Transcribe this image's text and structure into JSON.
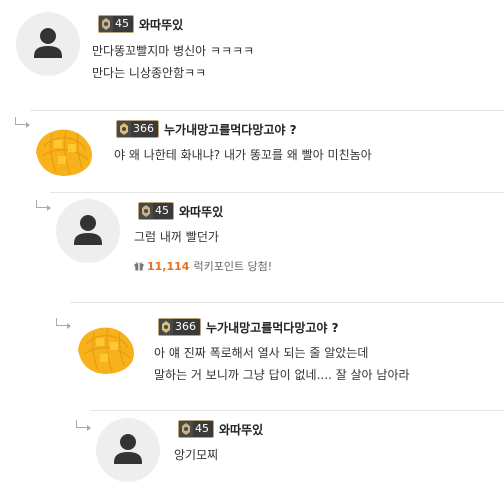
{
  "comments": [
    {
      "nickname": "와따뚜있",
      "level": "45",
      "avatar": "default-avatar",
      "lines": [
        "만다똥꼬빨지마 병신아 ㅋㅋㅋㅋ",
        "만다는 니상종안함ㅋㅋ"
      ]
    },
    {
      "nickname": "누가내망고를먹다망고야 ?",
      "level": "366",
      "avatar": "mango-avatar",
      "lines": [
        "야 왜 나한테 화내냐? 내가 똥꼬를 왜 빨아 미친놈아"
      ]
    },
    {
      "nickname": "와따뚜있",
      "level": "45",
      "avatar": "default-avatar",
      "lines": [
        "그럼 내꺼 빨던가"
      ],
      "lucky_points": "11,114",
      "lucky_label": "럭키포인트 당첨!"
    },
    {
      "nickname": "누가내망고를먹다망고야 ?",
      "level": "366",
      "avatar": "mango-avatar",
      "lines": [
        "아 얘 진짜 폭로해서 열사 되는 줄 알았는데",
        "말하는 거 보니까 그냥 답이 없네.... 잘 살아 남아라"
      ]
    },
    {
      "nickname": "와따뚜있",
      "level": "45",
      "avatar": "default-avatar",
      "lines": [
        "앙기모찌"
      ]
    }
  ],
  "colors": {
    "lucky_points": "#e8701a",
    "divider": "#e6e6e6",
    "level_badge_bg": "#3b3a39"
  },
  "icons": [
    "default-user-icon",
    "mango-photo",
    "level-badge-icon",
    "reply-arrow-icon",
    "gift-icon"
  ]
}
